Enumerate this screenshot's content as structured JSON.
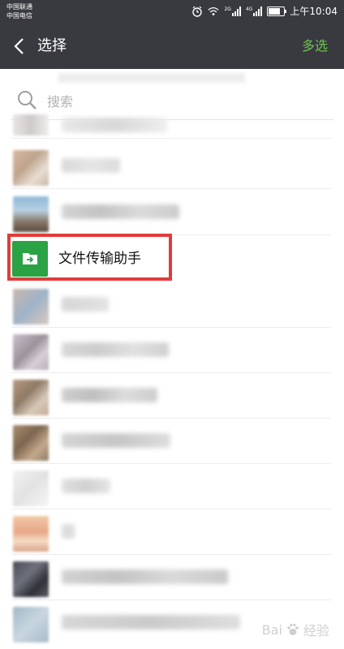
{
  "status_bar": {
    "carrier_1": "中国联通",
    "carrier_2": "中国电信",
    "time": "上午10:04",
    "net_1": "2G",
    "net_2": "4G"
  },
  "header": {
    "title": "选择",
    "multi_select_label": "多选",
    "background": "#393a3f",
    "accent": "#6ec34f"
  },
  "search": {
    "placeholder": "搜索",
    "value": ""
  },
  "highlighted_item": {
    "name": "文件传输助手",
    "icon": "folder-transfer-icon",
    "icon_color": "#2ba244",
    "highlight_color": "#e23b3b"
  },
  "contacts_note": "names and avatars pixelated/blurred",
  "watermark": {
    "text": "Bai",
    "text2": "经验"
  }
}
